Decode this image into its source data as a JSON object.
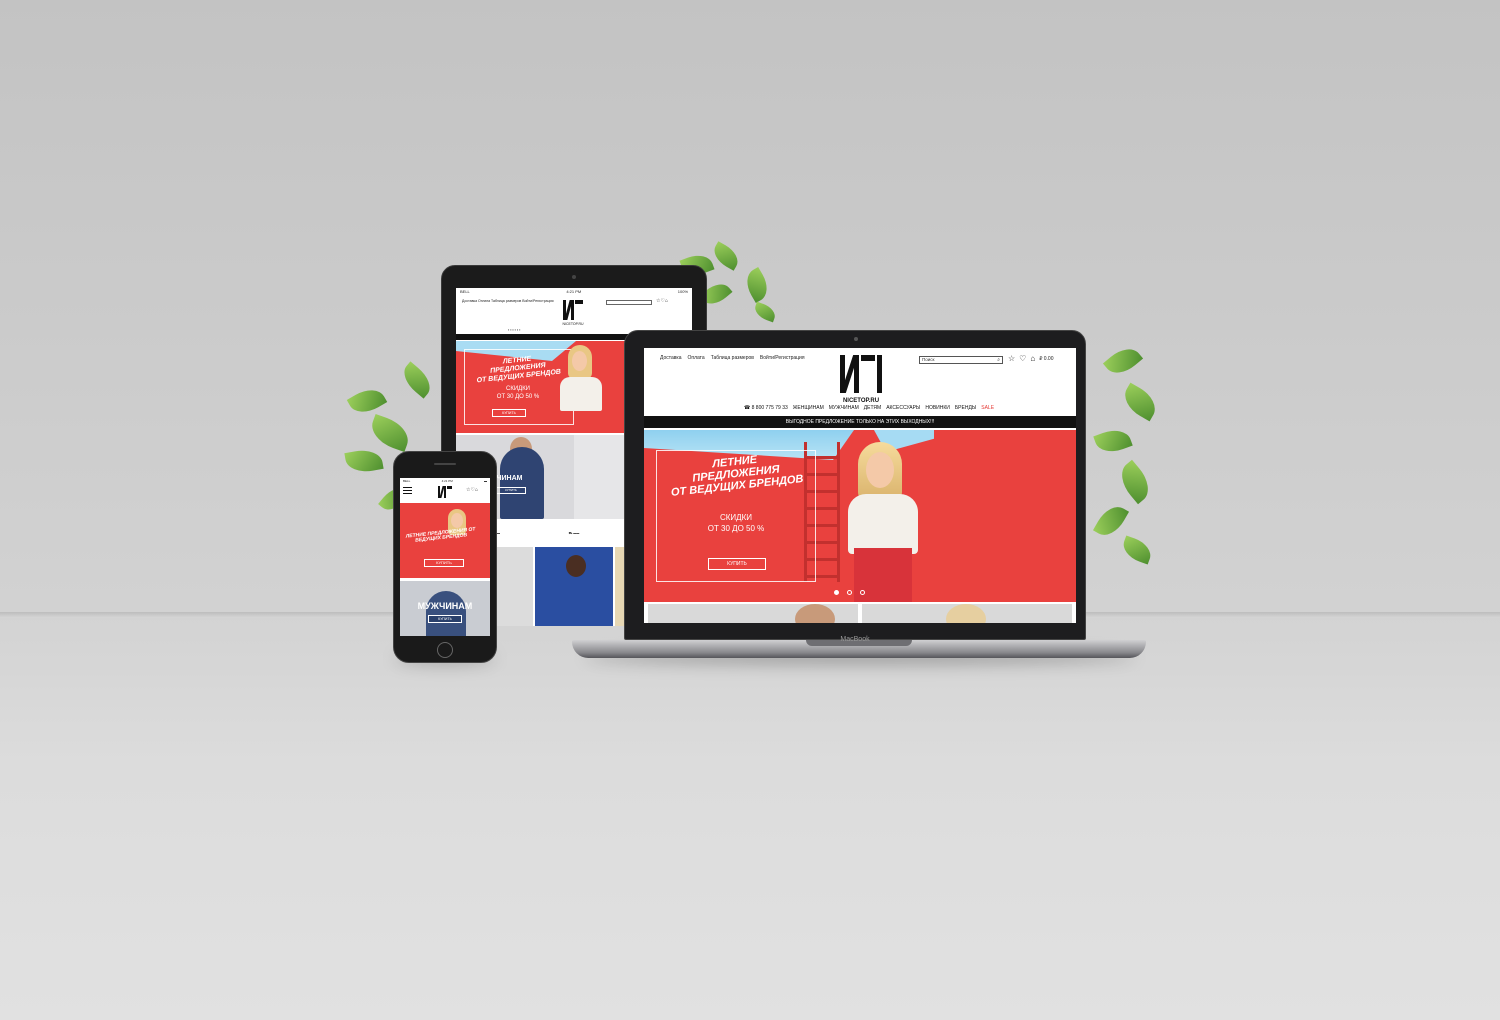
{
  "laptop": {
    "brand_label": "MacBook",
    "header": {
      "links": [
        "Доставка",
        "Оплата",
        "Таблица размеров",
        "Войти/Регистрация"
      ],
      "logo_text": "NICETOP.RU",
      "search_placeholder": "Поиск",
      "price": "₽ 0.00",
      "phone": "8 800 775 79 33",
      "nav": [
        "ЖЕНЩИНАМ",
        "МУЖЧИНАМ",
        "ДЕТЯМ",
        "АКСЕССУАРЫ",
        "НОВИНКИ",
        "БРЕНДЫ",
        "SALE"
      ]
    },
    "promo_bar": "ВЫГОДНОЕ ПРЕДЛОЖЕНИЕ ТОЛЬКО НА ЭТИХ ВЫХОДНЫХ!!!",
    "hero": {
      "title_line1": "ЛЕТНИЕ",
      "title_line2": "ПРЕДЛОЖЕНИЯ",
      "title_line3": "ОТ ВЕДУЩИХ БРЕНДОВ",
      "discount_line1": "СКИДКИ",
      "discount_line2": "ОТ 30 ДО 50 %",
      "button": "КУПИТЬ"
    }
  },
  "tablet": {
    "status_time": "4:21 PM",
    "status_left": "BELL",
    "status_right": "100%",
    "links": "Доставка   Оплата   Таблица размеров   Войти/Регистрация",
    "logo_text": "NICETOP.RU",
    "hero": {
      "title_line1": "ЛЕТНИЕ",
      "title_line2": "ПРЕДЛОЖЕНИЯ",
      "title_line3": "ОТ ВЕДУЩИХ БРЕНДОВ",
      "discount_line1": "СКИДКИ",
      "discount_line2": "ОТ 30 ДО 50 %",
      "button": "КУПИТЬ"
    },
    "men": {
      "label": "МУЖЧИНАМ",
      "button": "КУПИТЬ"
    }
  },
  "phone": {
    "status_left": "BELL",
    "status_time": "4:21 PM",
    "hero": {
      "title": "ЛЕТНИЕ ПРЕДЛОЖЕНИЯ ОТ ВЕДУЩИХ БРЕНДОВ",
      "button": "КУПИТЬ"
    },
    "men": {
      "label": "МУЖЧИНАМ",
      "button": "КУПИТЬ"
    }
  },
  "colors": {
    "accent": "#e9413e",
    "dark": "#111111",
    "sale": "#e53935"
  },
  "icons": [
    "search-icon",
    "star-icon",
    "heart-icon",
    "bag-icon",
    "hamburger-icon"
  ]
}
